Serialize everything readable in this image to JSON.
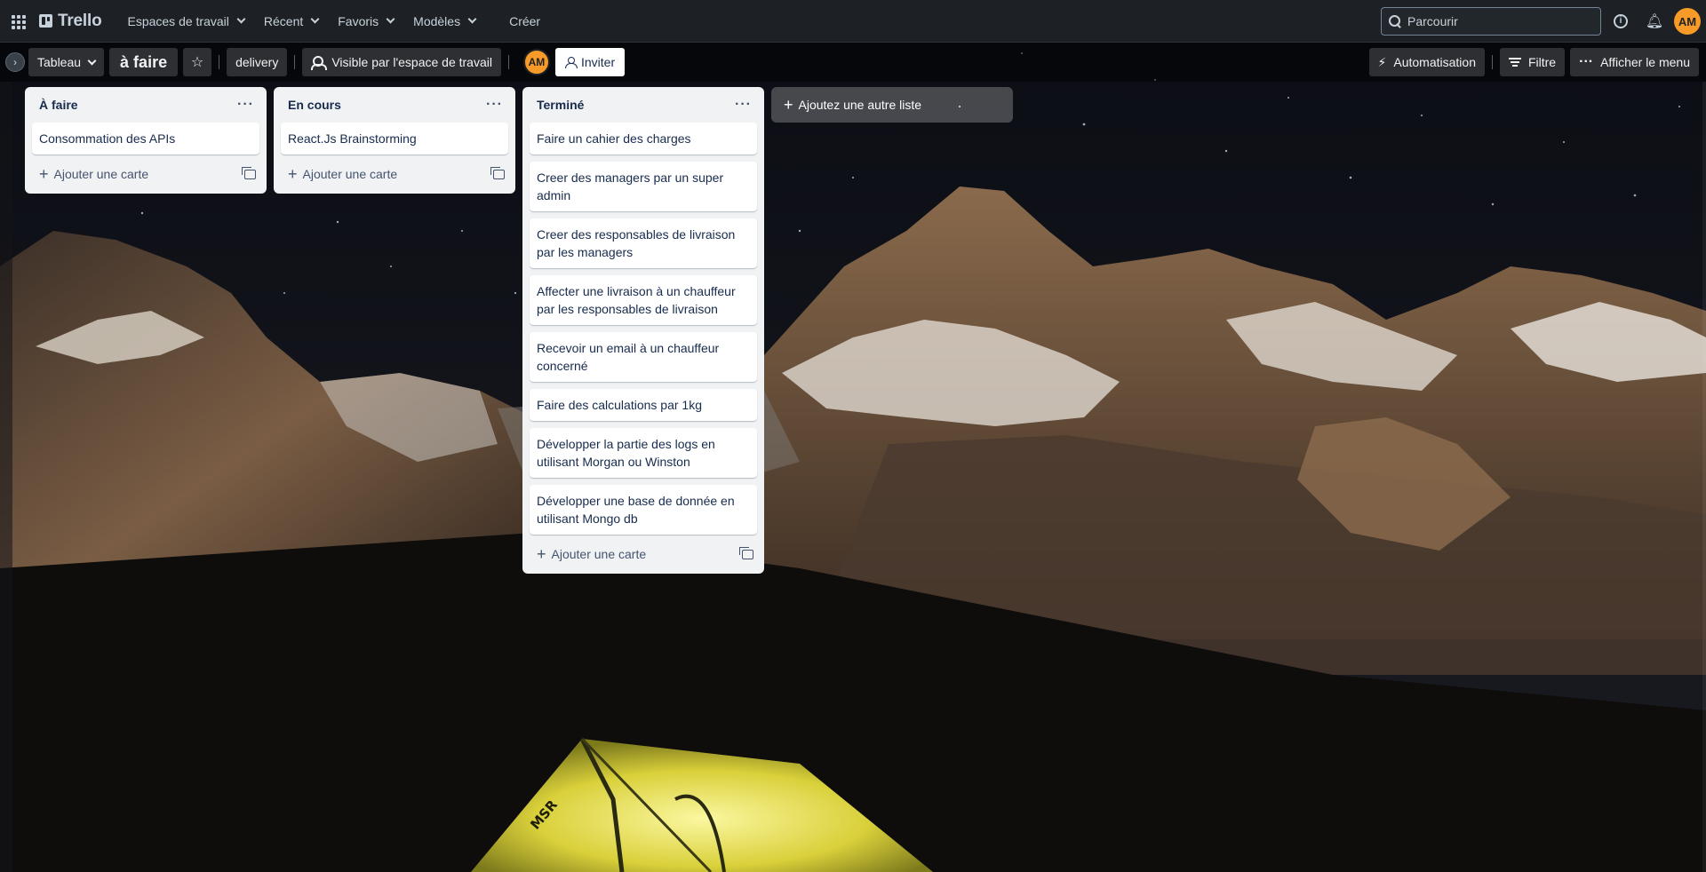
{
  "topbar": {
    "logo": "Trello",
    "menu": [
      {
        "label": "Espaces de travail"
      },
      {
        "label": "Récent"
      },
      {
        "label": "Favoris"
      },
      {
        "label": "Modèles"
      }
    ],
    "create": "Créer",
    "search_placeholder": "Parcourir",
    "avatar": "AM"
  },
  "boardbar": {
    "view": "Tableau",
    "title": "à faire",
    "workspace": "delivery",
    "visibility": "Visible par l'espace de travail",
    "member": "AM",
    "invite": "Inviter",
    "automation": "Automatisation",
    "filter": "Filtre",
    "show_menu": "Afficher le menu"
  },
  "lists": [
    {
      "title": "À faire",
      "cards": [
        "Consommation des APIs"
      ],
      "add_card": "Ajouter une carte"
    },
    {
      "title": "En cours",
      "cards": [
        "React.Js Brainstorming"
      ],
      "add_card": "Ajouter une carte"
    },
    {
      "title": "Terminé",
      "cards": [
        "Faire un cahier des charges",
        "Creer des managers par un super admin",
        "Creer des responsables de livraison par les managers",
        "Affecter une livraison à un chauffeur par les responsables de livraison",
        "Recevoir un email à un chauffeur concerné",
        "Faire des calculations par 1kg",
        "Développer la partie des logs en utilisant Morgan ou Winston",
        "Développer une base de donnée en utilisant Mongo db"
      ],
      "add_card": "Ajouter une carte"
    }
  ],
  "add_list": "Ajoutez une autre liste",
  "background": {
    "tent_label": "MSR",
    "sky": "#0d0f16",
    "rock": "#5a4a3c",
    "snow": "#e8e4de",
    "tent": "#e7e24a"
  }
}
